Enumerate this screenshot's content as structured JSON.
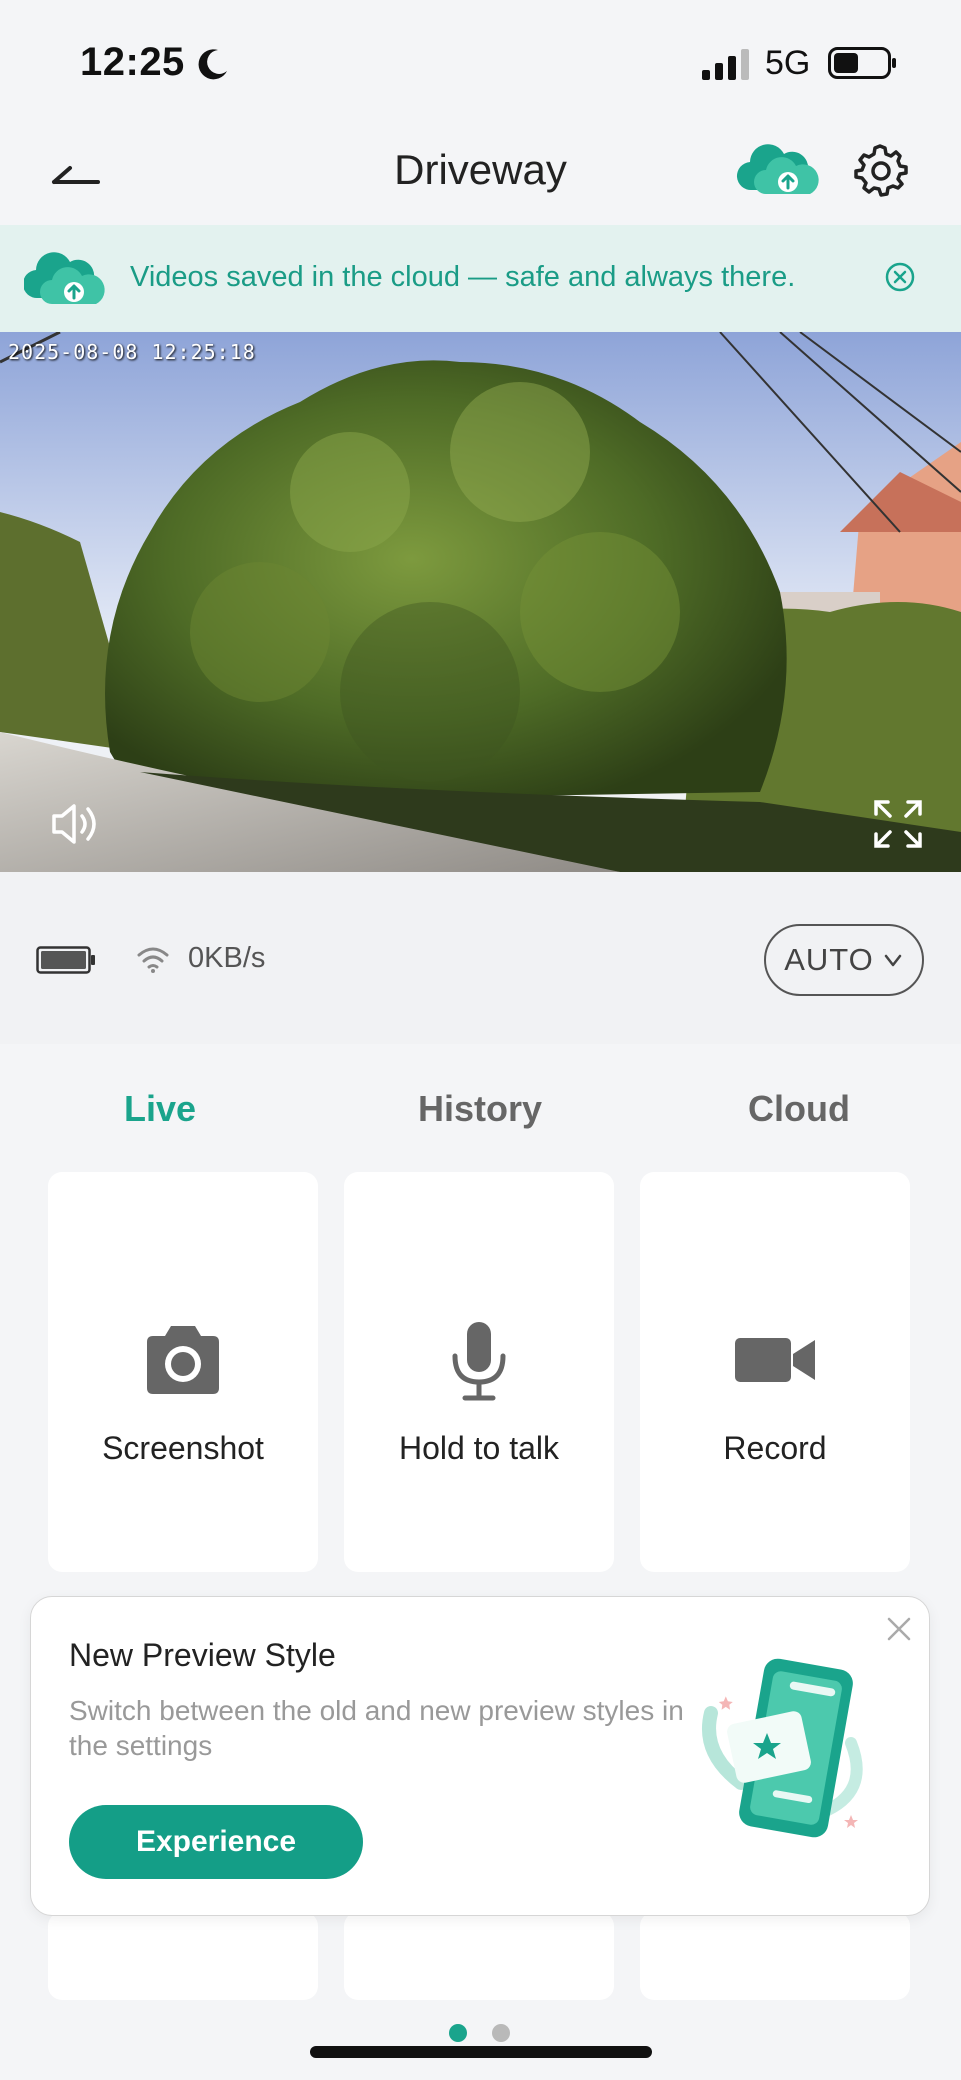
{
  "status_bar": {
    "time": "12:25",
    "network": "5G"
  },
  "header": {
    "title": "Driveway"
  },
  "banner": {
    "text": "Videos saved in the cloud — safe and always there."
  },
  "video": {
    "timestamp": "2025-08-08 12:25:18"
  },
  "info_bar": {
    "speed": "0KB/s",
    "quality": "AUTO"
  },
  "tabs": [
    {
      "label": "Live",
      "active": true
    },
    {
      "label": "History",
      "active": false
    },
    {
      "label": "Cloud",
      "active": false
    }
  ],
  "actions": [
    {
      "label": "Screenshot",
      "icon": "camera-icon"
    },
    {
      "label": "Hold to talk",
      "icon": "microphone-icon"
    },
    {
      "label": "Record",
      "icon": "video-camera-icon"
    }
  ],
  "popup": {
    "title": "New Preview Style",
    "description": "Switch between the old and new preview styles in the settings",
    "button_label": "Experience"
  },
  "pagination": {
    "total": 2,
    "current": 1
  },
  "colors": {
    "accent": "#1aa48c",
    "banner_bg": "#e3f2ef",
    "button": "#149e87"
  }
}
